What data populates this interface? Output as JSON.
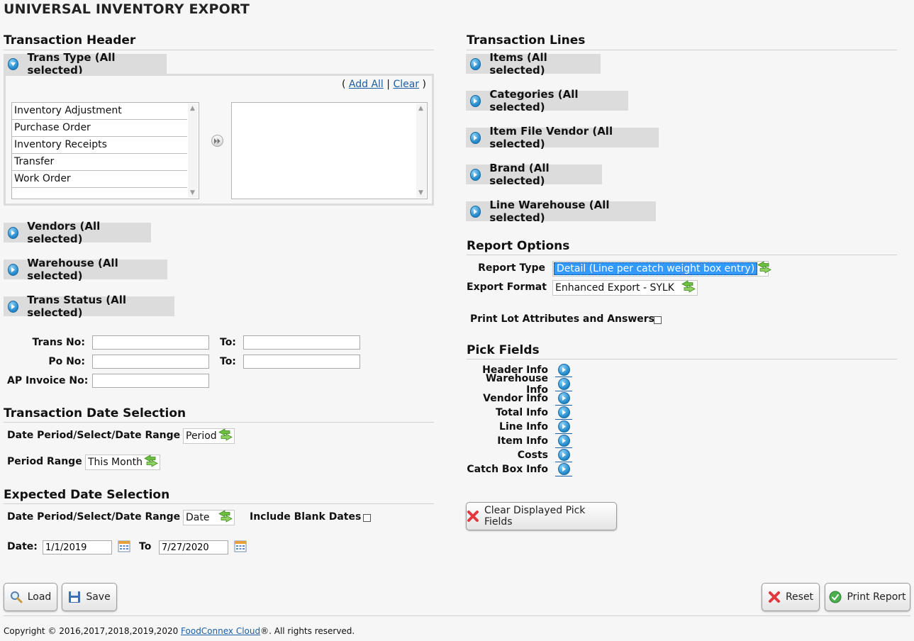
{
  "page_title": "UNIVERSAL INVENTORY EXPORT",
  "header": {
    "title": "Transaction Header",
    "trans_type_label": "Trans Type (All selected)",
    "add_all": "Add All",
    "clear": "Clear",
    "sep_open": "(",
    "sep_mid": "|",
    "sep_close": ")",
    "trans_type_options": [
      "Inventory Adjustment",
      "Purchase Order",
      "Inventory Receipts",
      "Transfer",
      "Work Order"
    ],
    "vendors_label": "Vendors (All selected)",
    "warehouse_label": "Warehouse (All selected)",
    "trans_status_label": "Trans Status (All selected)",
    "trans_no_label": "Trans No:",
    "po_no_label": "Po No:",
    "ap_invoice_label": "AP Invoice No:",
    "to_label": "To:"
  },
  "trans_date": {
    "title": "Transaction Date Selection",
    "date_period_label": "Date Period/Select/Date Range",
    "date_period_value": "Period",
    "period_range_label": "Period Range",
    "period_range_value": "This Month"
  },
  "expected_date": {
    "title": "Expected Date Selection",
    "date_period_label": "Date Period/Select/Date Range",
    "date_period_value": "Date",
    "include_blank_label": "Include Blank Dates",
    "date_label": "Date:",
    "date_from": "1/1/2019",
    "to_label": "To",
    "date_to": "7/27/2020"
  },
  "lines": {
    "title": "Transaction Lines",
    "items": "Items (All selected)",
    "categories": "Categories (All selected)",
    "item_file_vendor": "Item File Vendor (All selected)",
    "brand": "Brand (All selected)",
    "line_warehouse": "Line Warehouse (All selected)"
  },
  "report_options": {
    "title": "Report Options",
    "report_type_label": "Report Type",
    "report_type_value": "Detail (Line per catch weight box entry)",
    "export_format_label": "Export Format",
    "export_format_value": "Enhanced Export - SYLK",
    "print_lot_label": "Print Lot Attributes and Answers:"
  },
  "pick_fields": {
    "title": "Pick Fields",
    "items": [
      "Header Info",
      "Warehouse Info",
      "Vendor Info",
      "Total Info",
      "Line Info",
      "Item Info",
      "Costs",
      "Catch Box Info"
    ],
    "clear_button": "Clear Displayed Pick Fields"
  },
  "buttons": {
    "load": "Load",
    "save": "Save",
    "reset": "Reset",
    "print": "Print Report"
  },
  "footer": {
    "prefix": "Copyright © 2016,2017,2018,2019,2020 ",
    "link": "FoodConnex Cloud",
    "suffix": "®. All rights reserved."
  },
  "icons": {
    "toggle": "expand-circle-icon",
    "dropdown": "green-arrows-icon",
    "calendar": "calendar-icon"
  },
  "colors": {
    "accent": "#1f86c9",
    "link": "#1a5fa8",
    "selection": "#3399ff",
    "bar_bg": "#dcdcdc"
  }
}
